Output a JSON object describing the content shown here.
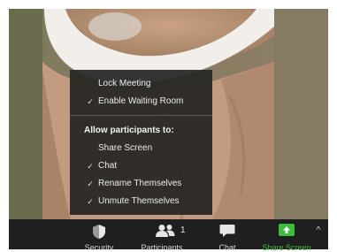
{
  "host_menu": {
    "items": [
      {
        "label": "Lock Meeting",
        "checked": false
      },
      {
        "label": "Enable Waiting Room",
        "checked": true
      }
    ],
    "allow_heading": "Allow participants to:",
    "allow_items": [
      {
        "label": "Share Screen",
        "checked": false
      },
      {
        "label": "Chat",
        "checked": true
      },
      {
        "label": "Rename Themselves",
        "checked": true
      },
      {
        "label": "Unmute Themselves",
        "checked": true
      }
    ],
    "check_glyph": "✓"
  },
  "toolbar": {
    "security_label": "Security",
    "participants_label": "Participants",
    "participants_count": "1",
    "chat_label": "Chat",
    "share_label": "Share Screen",
    "share_color": "#3dbb3d",
    "more_glyph": "^"
  },
  "icons": {
    "security": "shield-icon",
    "participants": "participants-icon",
    "chat": "chat-bubble-icon",
    "share": "share-screen-icon",
    "caret": "caret-up-icon"
  }
}
